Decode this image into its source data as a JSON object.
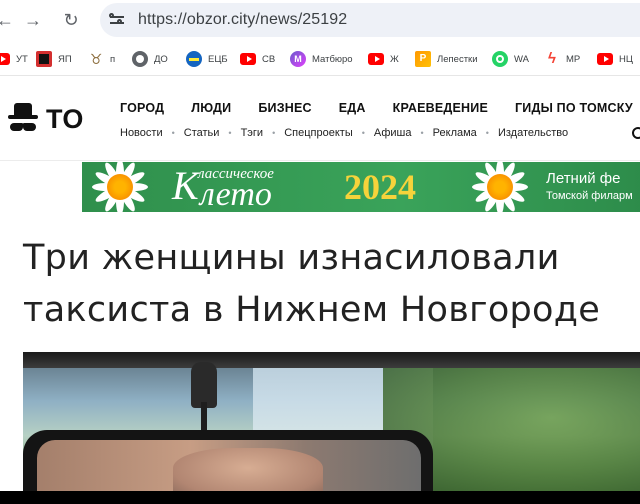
{
  "browser": {
    "url": "https://obzor.city/news/25192",
    "back_icon": "←",
    "forward_icon": "→",
    "reload_icon": "↻"
  },
  "bookmarks": [
    {
      "label": "УТ",
      "icon": "youtube-icon"
    },
    {
      "label": "ЯП",
      "icon": "yap-icon"
    },
    {
      "label": "п",
      "icon": "fox-icon"
    },
    {
      "label": "ДО",
      "icon": "globe-icon"
    },
    {
      "label": "ЕЦБ",
      "icon": "ecb-icon"
    },
    {
      "label": "СВ",
      "icon": "youtube-icon"
    },
    {
      "label": "Матбюро",
      "icon": "m-icon"
    },
    {
      "label": "Ж",
      "icon": "youtube-icon"
    },
    {
      "label": "Лепестки",
      "icon": "flag-icon"
    },
    {
      "label": "WA",
      "icon": "whatsapp-icon"
    },
    {
      "label": "МР",
      "icon": "bolt-icon"
    },
    {
      "label": "НЦ",
      "icon": "youtube-icon"
    }
  ],
  "site": {
    "logo_text": "ТО",
    "main_nav": [
      "ГОРОД",
      "ЛЮДИ",
      "БИЗНЕС",
      "ЕДА",
      "КРАЕВЕДЕНИЕ",
      "ГИДЫ ПО ТОМСКУ"
    ],
    "sub_nav": [
      "Новости",
      "Статьи",
      "Тэги",
      "Спецпроекты",
      "Афиша",
      "Реклама",
      "Издательство"
    ],
    "separator": "•"
  },
  "banner": {
    "title_initial": "К",
    "title_small": "лассическое",
    "title_rest": "лето",
    "year": "2024",
    "right_title": "Летний фе",
    "right_subtitle": "Томской филарм"
  },
  "article": {
    "headline": "Три женщины изнасиловали таксиста в Нижнем Новгороде"
  },
  "colors": {
    "banner_green": "#3aa35a",
    "banner_year": "#f6d33b",
    "text": "#222222"
  }
}
